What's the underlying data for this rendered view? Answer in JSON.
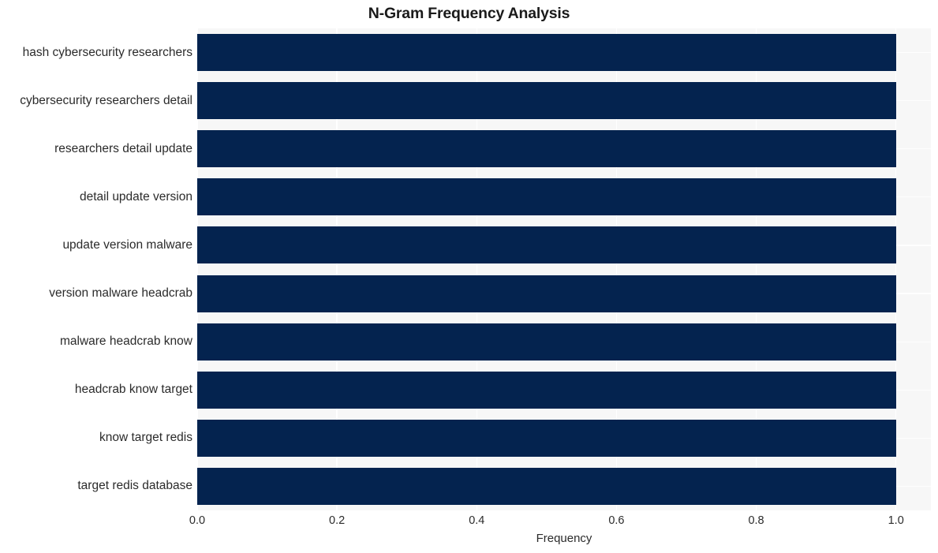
{
  "chart_data": {
    "type": "bar",
    "orientation": "horizontal",
    "title": "N-Gram Frequency Analysis",
    "xlabel": "Frequency",
    "ylabel": "",
    "categories": [
      "hash cybersecurity researchers",
      "cybersecurity researchers detail",
      "researchers detail update",
      "detail update version",
      "update version malware",
      "version malware headcrab",
      "malware headcrab know",
      "headcrab know target",
      "know target redis",
      "target redis database"
    ],
    "values": [
      1.0,
      1.0,
      1.0,
      1.0,
      1.0,
      1.0,
      1.0,
      1.0,
      1.0,
      1.0
    ],
    "xlim": [
      0.0,
      1.05
    ],
    "xticks": [
      "0.0",
      "0.2",
      "0.4",
      "0.6",
      "0.8",
      "1.0"
    ],
    "xtick_values": [
      0.0,
      0.2,
      0.4,
      0.6,
      0.8,
      1.0
    ],
    "grid": true,
    "legend": false,
    "bar_color": "#04234f",
    "plot_background": "#f7f7f7",
    "gridline_color": "#ffffff",
    "figure_background": "#ffffff",
    "text_color": "#2b2b2b"
  }
}
